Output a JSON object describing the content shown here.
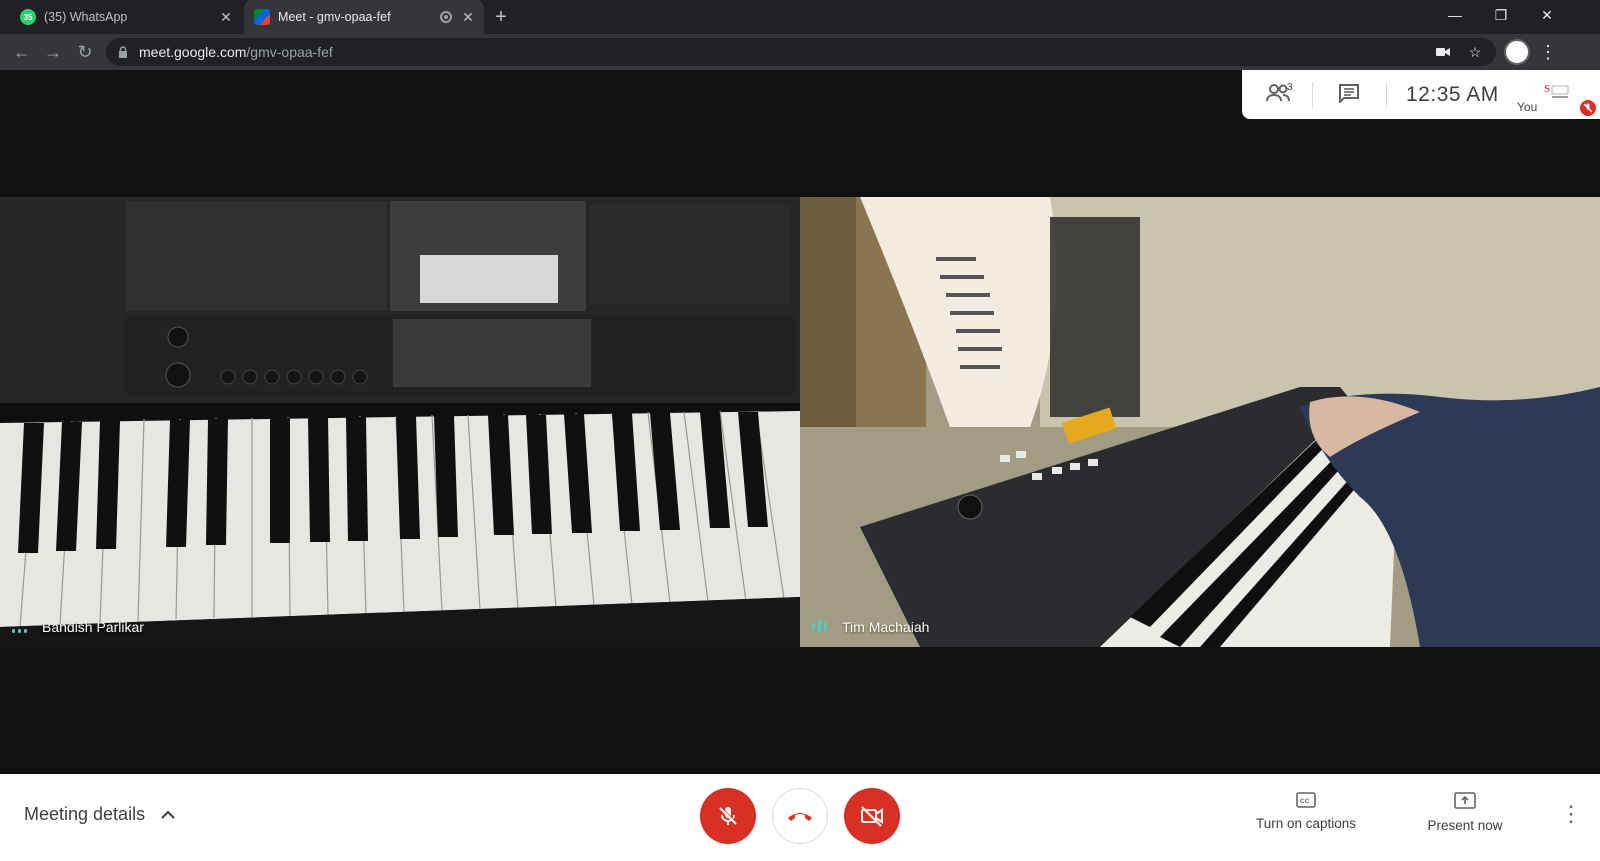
{
  "browser": {
    "tabs": [
      {
        "title": "(35) WhatsApp",
        "badge": "35",
        "favicon": "whatsapp-icon",
        "active": false
      },
      {
        "title": "Meet - gmv-opaa-fef",
        "favicon": "meet-icon",
        "active": true
      }
    ],
    "url_host": "meet.google.com",
    "url_path": "/gmv-opaa-fef"
  },
  "meet": {
    "participants_count": "3",
    "time": "12:35 AM",
    "you_label": "You",
    "participants": [
      {
        "name": "Bandish Parlikar",
        "speaking": false
      },
      {
        "name": "Tim Machaiah",
        "speaking": true
      }
    ]
  },
  "controls": {
    "meeting_details": "Meeting details",
    "captions_label": "Turn on captions",
    "present_label": "Present now",
    "mic_muted": true,
    "camera_off": true
  },
  "colors": {
    "red": "#d93025",
    "accent_speaking": "#4ecdc4"
  }
}
